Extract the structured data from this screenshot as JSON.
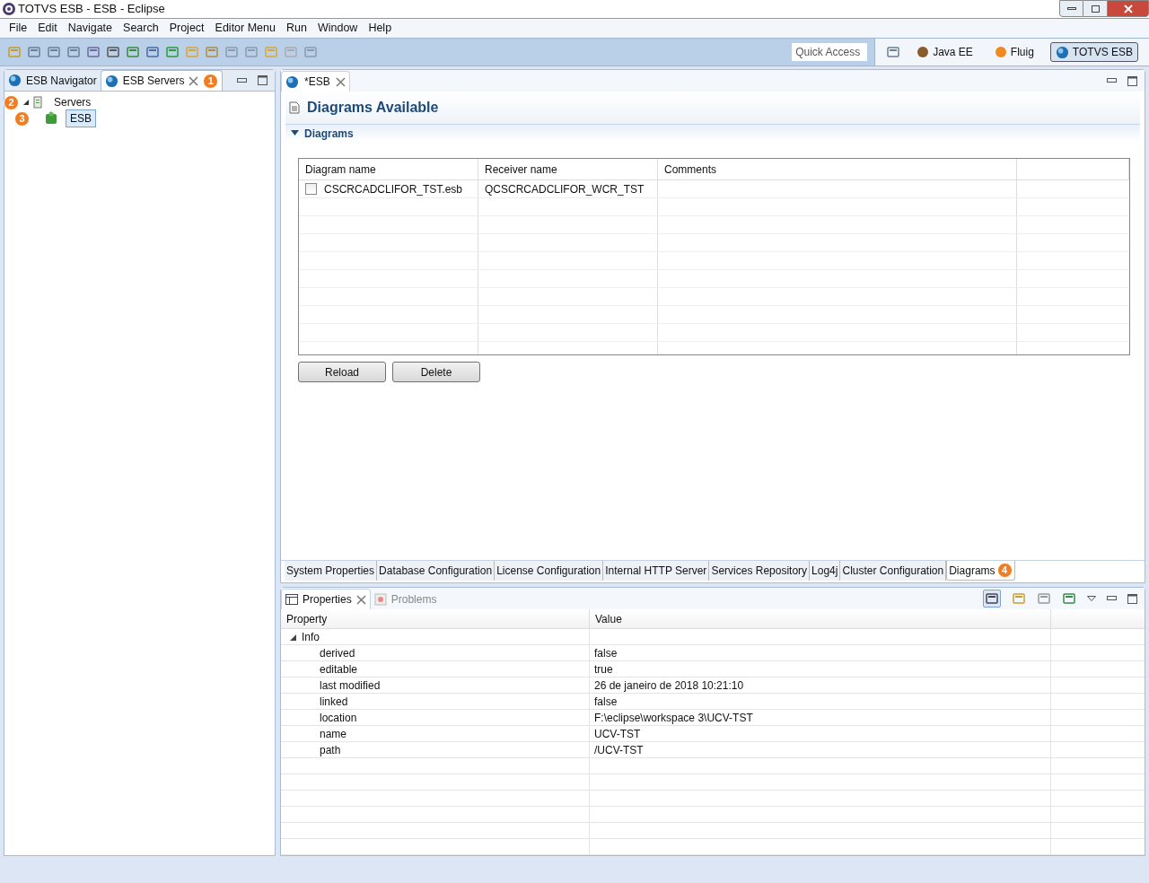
{
  "window": {
    "title": "TOTVS ESB - ESB - Eclipse"
  },
  "menu": [
    "File",
    "Edit",
    "Navigate",
    "Search",
    "Project",
    "Editor Menu",
    "Run",
    "Window",
    "Help"
  ],
  "quick_access": {
    "placeholder": "Quick Access"
  },
  "perspectives": [
    {
      "label": "Java EE",
      "selected": false
    },
    {
      "label": "Fluig",
      "selected": false
    },
    {
      "label": "TOTVS ESB",
      "selected": true
    }
  ],
  "left_panel": {
    "tabs": [
      {
        "label": "ESB Navigator",
        "selected": false
      },
      {
        "label": "ESB Servers",
        "selected": true,
        "badge": "1"
      }
    ],
    "tree": [
      {
        "label": "Servers",
        "expanded": true,
        "selected": false,
        "badge": "2",
        "children": [
          {
            "label": "ESB",
            "selected": true,
            "badge": "3"
          }
        ]
      }
    ]
  },
  "editor": {
    "tab": {
      "label": "*ESB"
    },
    "title": "Diagrams Available",
    "section": {
      "label": "Diagrams",
      "expanded": true
    },
    "table": {
      "columns": [
        "Diagram name",
        "Receiver name",
        "Comments"
      ],
      "rows": [
        {
          "checked": false,
          "cells": [
            "CSCRCADCLIFOR_TST.esb",
            "QCSCRCADCLIFOR_WCR_TST",
            ""
          ]
        }
      ]
    },
    "buttons": [
      "Reload",
      "Delete"
    ],
    "bottom_tabs": [
      {
        "label": "System Properties",
        "selected": false
      },
      {
        "label": "Database Configuration",
        "selected": false
      },
      {
        "label": "License Configuration",
        "selected": false
      },
      {
        "label": "Internal HTTP Server",
        "selected": false
      },
      {
        "label": "Services Repository",
        "selected": false
      },
      {
        "label": "Log4j",
        "selected": false
      },
      {
        "label": "Cluster Configuration",
        "selected": false
      },
      {
        "label": "Diagrams",
        "selected": true,
        "badge": "4"
      }
    ]
  },
  "properties": {
    "tabs": [
      {
        "label": "Properties",
        "selected": true
      },
      {
        "label": "Problems",
        "selected": false
      }
    ],
    "columns": [
      "Property",
      "Value"
    ],
    "group": {
      "label": "Info",
      "expanded": true,
      "rows": [
        {
          "property": "derived",
          "value": "false"
        },
        {
          "property": "editable",
          "value": "true"
        },
        {
          "property": "last modified",
          "value": "26 de janeiro de 2018 10:21:10"
        },
        {
          "property": "linked",
          "value": "false"
        },
        {
          "property": "location",
          "value": "F:\\eclipse\\workspace 3\\UCV-TST"
        },
        {
          "property": "name",
          "value": "UCV-TST"
        },
        {
          "property": "path",
          "value": "/UCV-TST"
        }
      ]
    }
  }
}
